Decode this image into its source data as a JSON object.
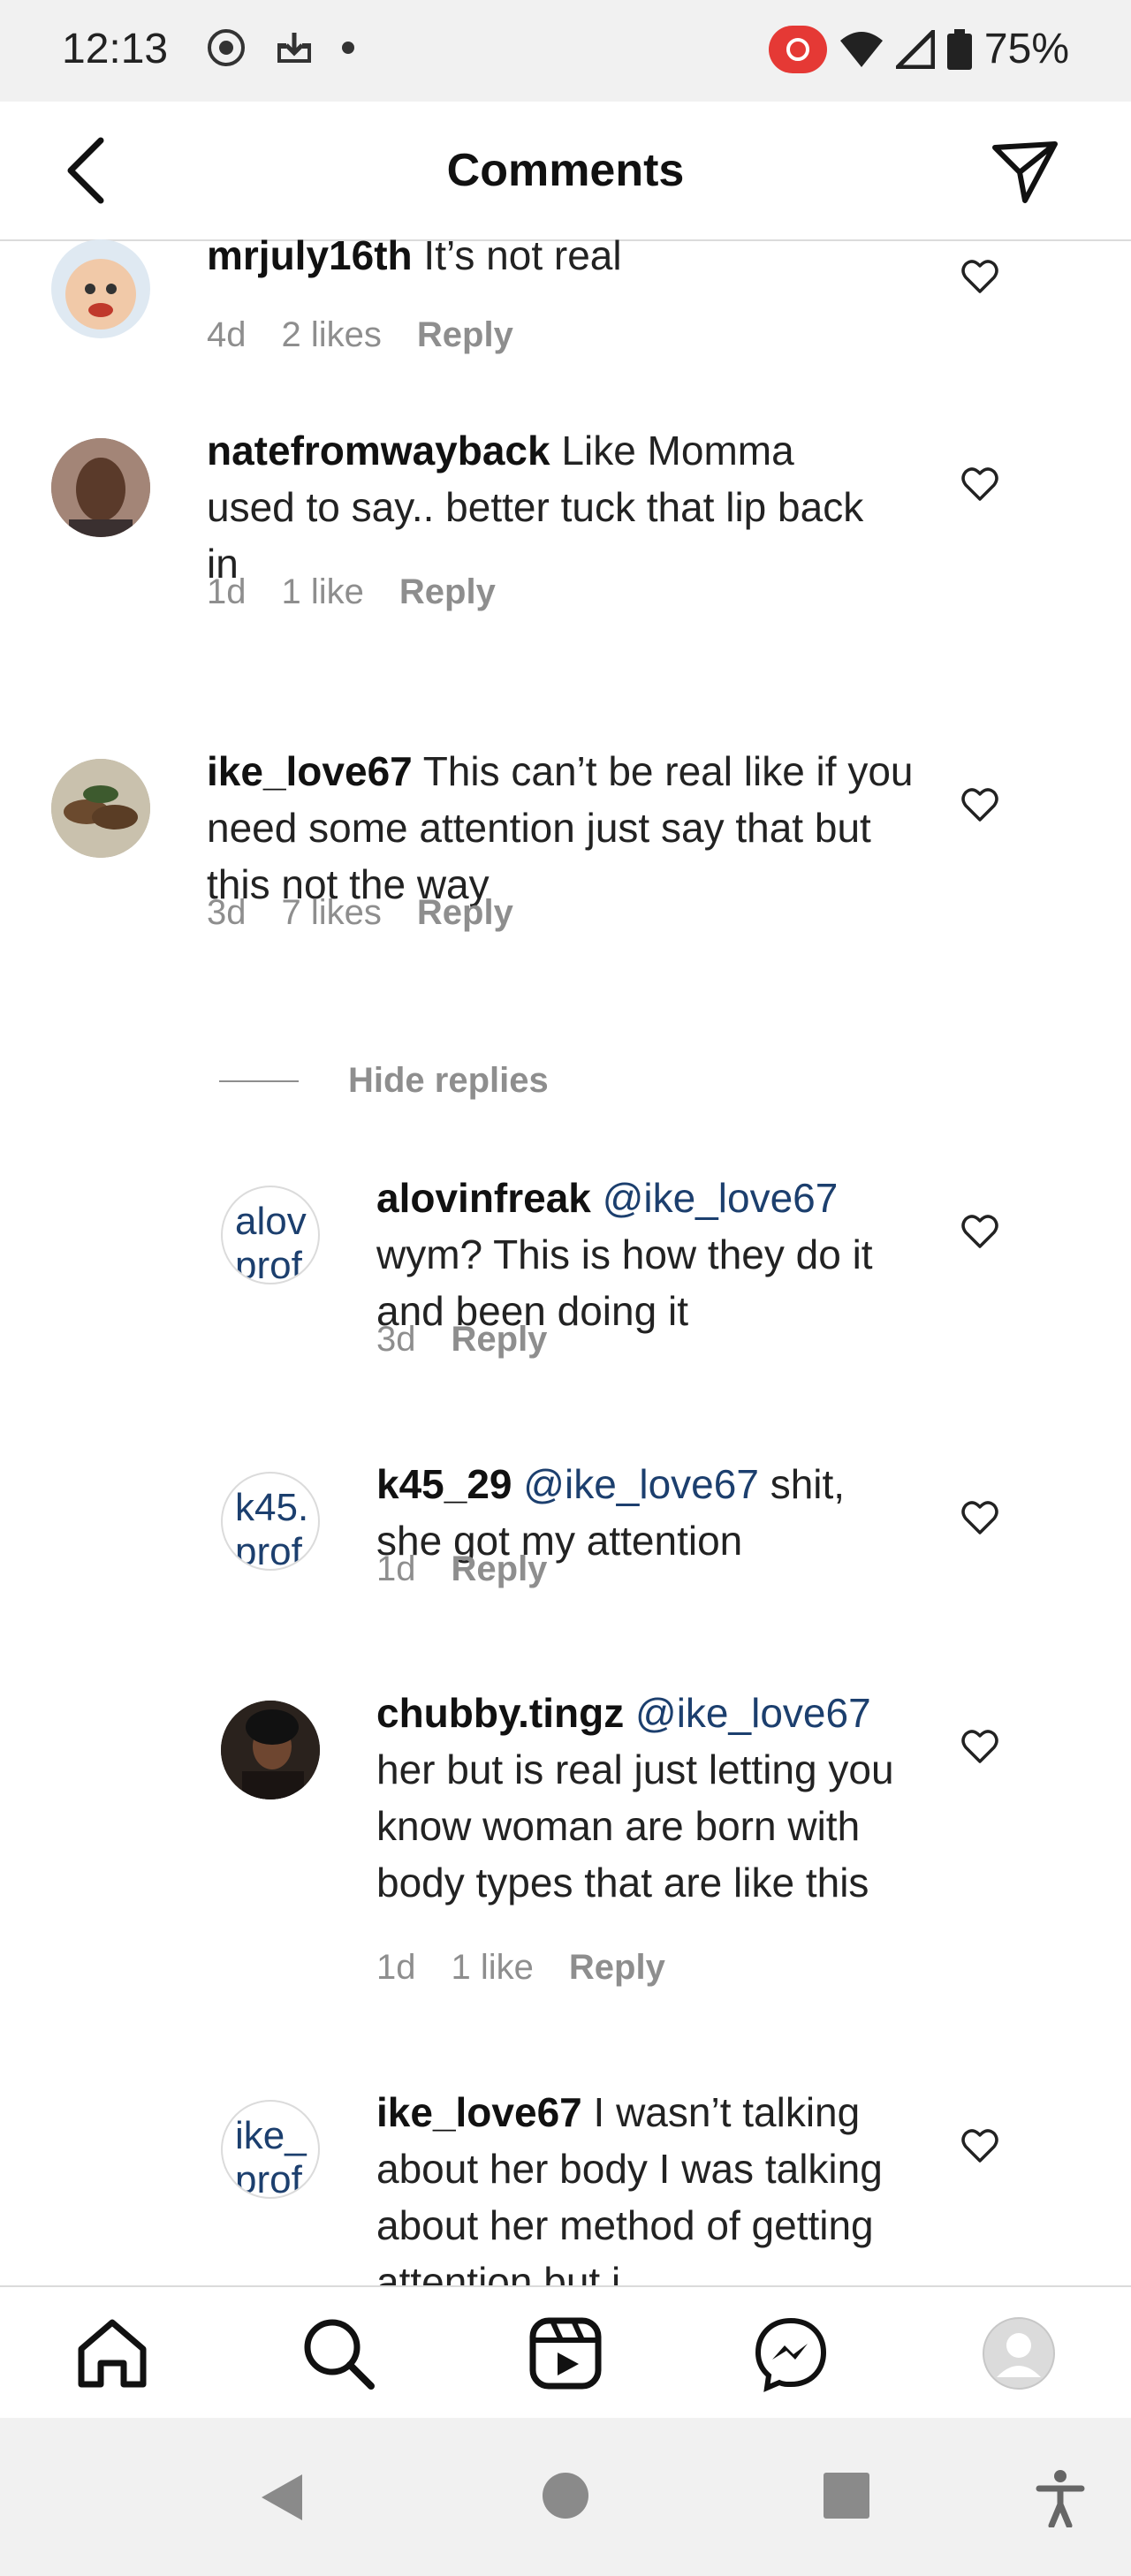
{
  "status_bar": {
    "time": "12:13",
    "battery": "75%"
  },
  "header": {
    "title": "Comments"
  },
  "hide_replies_label": "Hide replies",
  "comments": [
    {
      "username": "mrjuly16th",
      "text": " It’s not real",
      "age": "4d",
      "likes": "2 likes",
      "reply": "Reply"
    },
    {
      "username": "natefromwayback",
      "text": " Like Momma used to say.. better tuck that lip back in",
      "age": "1d",
      "likes": "1 like",
      "reply": "Reply"
    },
    {
      "username": "ike_love67",
      "text": " This can’t be real like if you need some attention just say that but this not the way",
      "age": "3d",
      "likes": "7 likes",
      "reply": "Reply"
    },
    {
      "username": "alovinfreak",
      "mention": "@ike_love67",
      "text": " wym? This is how they do it and been doing it",
      "age": "3d",
      "reply": "Reply",
      "avatar_text": "alov prof"
    },
    {
      "username": "k45_29",
      "mention": "@ike_love67",
      "text": " shit, she got my attention",
      "age": "1d",
      "reply": "Reply",
      "avatar_text": "k45. prof"
    },
    {
      "username": "chubby.tingz",
      "mention": "@ike_love67",
      "text": " her but is real just letting you know woman are born with body types that are like this",
      "age": "1d",
      "likes": "1 like",
      "reply": "Reply"
    },
    {
      "username": "ike_love67",
      "text": " I wasn’t talking about her body I was talking about her method of getting attention but i",
      "avatar_text": "ike_ prof"
    }
  ],
  "colors": {
    "accent": "#1c3f6e",
    "muted": "#8e8e8e",
    "record": "#e53935"
  },
  "icons": [
    "back-icon",
    "send-icon",
    "heart-icon",
    "home-icon",
    "search-icon",
    "reels-icon",
    "messenger-icon",
    "profile-icon"
  ]
}
